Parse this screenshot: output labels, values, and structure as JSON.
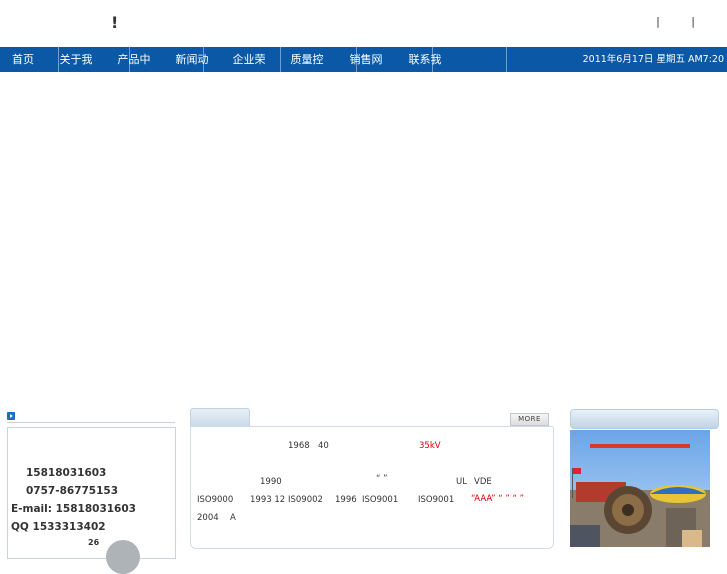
{
  "header": {
    "exclaim": "!",
    "links": "| |"
  },
  "nav": {
    "items": [
      "首页",
      "关于我们",
      "产品中心",
      "新闻动态",
      "企业荣誉",
      "质量控制",
      "销售网络",
      "联系我们"
    ],
    "clock": "2011年6月17日 星期五 AM7:20"
  },
  "contact": {
    "phone": "15818031603",
    "tel": "0757-86775153",
    "email": "E-mail: 15818031603",
    "qq": "QQ   1533313402",
    "num": "26"
  },
  "intro": {
    "more": "MORE",
    "line1": {
      "a": "1968",
      "b": "40",
      "c": "35kV"
    },
    "line2": {
      "a": "1990",
      "b": "“ ”",
      "c": "UL",
      "d": "VDE"
    },
    "line3": {
      "a": "ISO9000",
      "b": "1993 12",
      "c": "IS09002",
      "d": "1996",
      "e": "ISO9001",
      "f": "ISO9001",
      "g": "“AAA” “ ” “ ”"
    },
    "line4": {
      "a": "2004",
      "b": "A"
    }
  },
  "colors": {
    "nav": "#0a58a6",
    "red": "#e00000"
  }
}
